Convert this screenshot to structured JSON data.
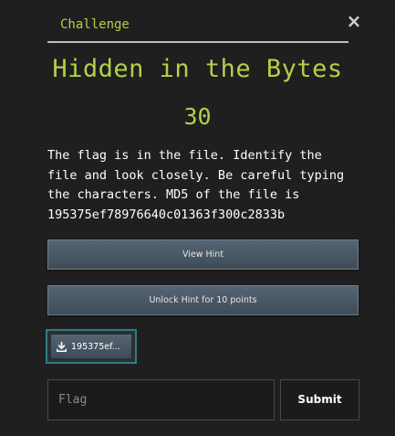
{
  "modal": {
    "tab_label": "Challenge",
    "close_symbol": "×",
    "title": "Hidden in the Bytes",
    "points": "30",
    "description_lines": [
      "The flag is in the file. Identify the",
      "file and look closely. Be careful typing",
      "the characters. MD5 of the file is",
      "195375ef78976640c01363f300c2833b"
    ]
  },
  "buttons": {
    "view_hint": "View Hint",
    "unlock_hint": "Unlock Hint for 10 points",
    "file_label": "195375ef...",
    "file_icon": "download-icon",
    "submit": "Submit"
  },
  "flag_input": {
    "placeholder": "Flag",
    "value": ""
  },
  "colors": {
    "accent": "#b3d04a",
    "button": "#4e5b68",
    "file_border": "#2d7c86",
    "background": "#1e1e1e"
  }
}
